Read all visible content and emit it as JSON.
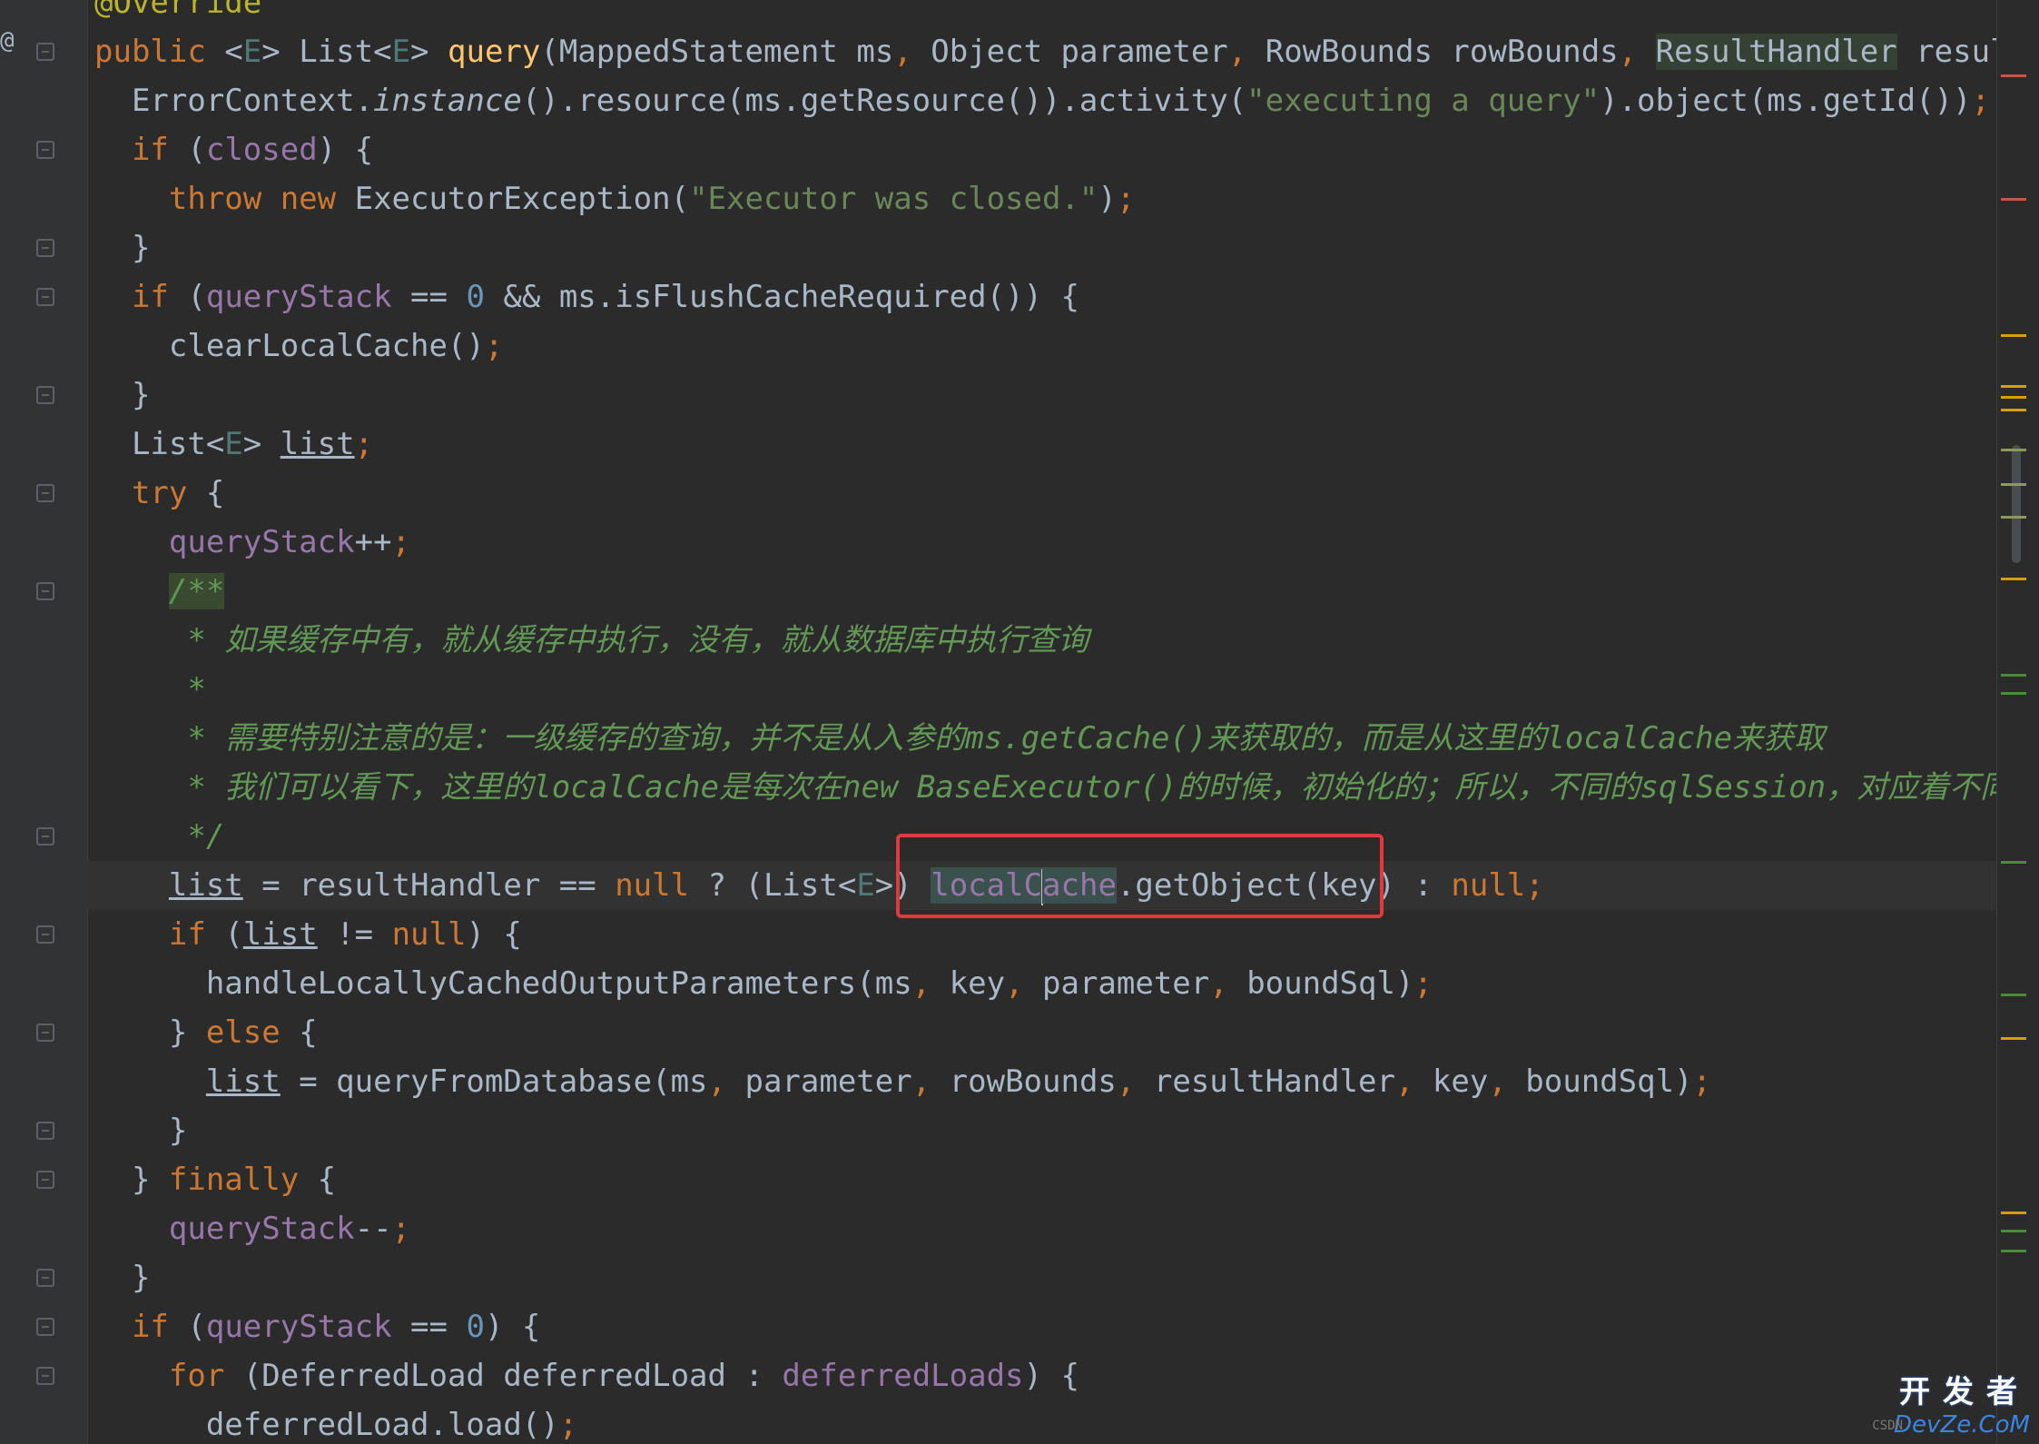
{
  "editor": {
    "gutter_symbol": "@",
    "lines": [
      [
        {
          "t": "@Override",
          "c": "ann"
        }
      ],
      [
        {
          "t": "public ",
          "c": "kw"
        },
        {
          "t": "<"
        },
        {
          "t": "E",
          "c": "gen"
        },
        {
          "t": "> List<"
        },
        {
          "t": "E",
          "c": "gen"
        },
        {
          "t": "> "
        },
        {
          "t": "query",
          "c": "fn"
        },
        {
          "t": "(MappedStatement ms"
        },
        {
          "t": ", ",
          "c": "kw"
        },
        {
          "t": "Object parameter"
        },
        {
          "t": ", ",
          "c": "kw"
        },
        {
          "t": "RowBounds rowBounds"
        },
        {
          "t": ", ",
          "c": "kw"
        },
        {
          "t": "ResultHandler",
          "c": "hl-type"
        },
        {
          "t": " resultHandler"
        }
      ],
      [
        {
          "t": "  ErrorContext."
        },
        {
          "t": "instance",
          "c": "ital"
        },
        {
          "t": "().resource(ms.getResource()).activity("
        },
        {
          "t": "\"executing a query\"",
          "c": "str"
        },
        {
          "t": ").object(ms.getId())"
        },
        {
          "t": ";",
          "c": "kw"
        }
      ],
      [
        {
          "t": "  "
        },
        {
          "t": "if ",
          "c": "kw"
        },
        {
          "t": "("
        },
        {
          "t": "closed",
          "c": "fld"
        },
        {
          "t": ") {"
        }
      ],
      [
        {
          "t": "    "
        },
        {
          "t": "throw new ",
          "c": "kw"
        },
        {
          "t": "ExecutorException("
        },
        {
          "t": "\"Executor was closed.\"",
          "c": "str"
        },
        {
          "t": ")"
        },
        {
          "t": ";",
          "c": "kw"
        }
      ],
      [
        {
          "t": "  }"
        }
      ],
      [
        {
          "t": "  "
        },
        {
          "t": "if ",
          "c": "kw"
        },
        {
          "t": "("
        },
        {
          "t": "queryStack",
          "c": "fld"
        },
        {
          "t": " == "
        },
        {
          "t": "0",
          "c": "num"
        },
        {
          "t": " && ms.isFlushCacheRequired()) {"
        }
      ],
      [
        {
          "t": "    clearLocalCache()"
        },
        {
          "t": ";",
          "c": "kw"
        }
      ],
      [
        {
          "t": "  }"
        }
      ],
      [
        {
          "t": "  List<"
        },
        {
          "t": "E",
          "c": "gen"
        },
        {
          "t": "> "
        },
        {
          "t": "list",
          "c": "ul"
        },
        {
          "t": ";",
          "c": "kw"
        }
      ],
      [
        {
          "t": "  "
        },
        {
          "t": "try ",
          "c": "kw"
        },
        {
          "t": "{"
        }
      ],
      [
        {
          "t": "    "
        },
        {
          "t": "queryStack",
          "c": "fld"
        },
        {
          "t": "++"
        },
        {
          "t": ";",
          "c": "kw"
        }
      ],
      [
        {
          "t": "    "
        },
        {
          "t": "/**",
          "c": "cmt hl-cmt"
        }
      ],
      [
        {
          "t": "     * 如果缓存中有，就从缓存中执行，没有，就从数据库中执行查询",
          "c": "cmt"
        }
      ],
      [
        {
          "t": "     *",
          "c": "cmt"
        }
      ],
      [
        {
          "t": "     * 需要特别注意的是：一级缓存的查询，并不是从入参的ms.getCache()来获取的，而是从这里的localCache来获取",
          "c": "cmt"
        }
      ],
      [
        {
          "t": "     * 我们可以看下，这里的localCache是每次在new BaseExecutor()的时候，初始化的；所以，不同的sqlSession，对应着不同的baseExecutor",
          "c": "cmt"
        }
      ],
      [
        {
          "t": "     */",
          "c": "cmt"
        }
      ],
      [
        {
          "t": "    "
        },
        {
          "t": "list",
          "c": "ul"
        },
        {
          "t": " = resultHandler == "
        },
        {
          "t": "null",
          "c": "kw"
        },
        {
          "t": " ? (List<"
        },
        {
          "t": "E",
          "c": "gen"
        },
        {
          "t": ">) "
        },
        {
          "t": "localC",
          "c": "hl-word"
        },
        {
          "t": "",
          "c": "caret"
        },
        {
          "t": "ache",
          "c": "hl-word"
        },
        {
          "t": ".getObject(key) : "
        },
        {
          "t": "null",
          "c": "kw"
        },
        {
          "t": ";",
          "c": "kw"
        }
      ],
      [
        {
          "t": "    "
        },
        {
          "t": "if ",
          "c": "kw"
        },
        {
          "t": "("
        },
        {
          "t": "list",
          "c": "ul"
        },
        {
          "t": " != "
        },
        {
          "t": "null",
          "c": "kw"
        },
        {
          "t": ") {"
        }
      ],
      [
        {
          "t": "      handleLocallyCachedOutputParameters(ms"
        },
        {
          "t": ", ",
          "c": "kw"
        },
        {
          "t": "key"
        },
        {
          "t": ", ",
          "c": "kw"
        },
        {
          "t": "parameter"
        },
        {
          "t": ", ",
          "c": "kw"
        },
        {
          "t": "boundSql)"
        },
        {
          "t": ";",
          "c": "kw"
        }
      ],
      [
        {
          "t": "    } "
        },
        {
          "t": "else ",
          "c": "kw"
        },
        {
          "t": "{"
        }
      ],
      [
        {
          "t": "      "
        },
        {
          "t": "list",
          "c": "ul"
        },
        {
          "t": " = queryFromDatabase(ms"
        },
        {
          "t": ", ",
          "c": "kw"
        },
        {
          "t": "parameter"
        },
        {
          "t": ", ",
          "c": "kw"
        },
        {
          "t": "rowBounds"
        },
        {
          "t": ", ",
          "c": "kw"
        },
        {
          "t": "resultHandler"
        },
        {
          "t": ", ",
          "c": "kw"
        },
        {
          "t": "key"
        },
        {
          "t": ", ",
          "c": "kw"
        },
        {
          "t": "boundSql)"
        },
        {
          "t": ";",
          "c": "kw"
        }
      ],
      [
        {
          "t": "    }"
        }
      ],
      [
        {
          "t": "  } "
        },
        {
          "t": "finally ",
          "c": "kw"
        },
        {
          "t": "{"
        }
      ],
      [
        {
          "t": "    "
        },
        {
          "t": "queryStack",
          "c": "fld"
        },
        {
          "t": "--"
        },
        {
          "t": ";",
          "c": "kw"
        }
      ],
      [
        {
          "t": "  }"
        }
      ],
      [
        {
          "t": "  "
        },
        {
          "t": "if ",
          "c": "kw"
        },
        {
          "t": "("
        },
        {
          "t": "queryStack",
          "c": "fld"
        },
        {
          "t": " == "
        },
        {
          "t": "0",
          "c": "num"
        },
        {
          "t": ") {"
        }
      ],
      [
        {
          "t": "    "
        },
        {
          "t": "for ",
          "c": "kw"
        },
        {
          "t": "(DeferredLoad deferredLoad : "
        },
        {
          "t": "deferredLoads",
          "c": "fld"
        },
        {
          "t": ") {"
        }
      ],
      [
        {
          "t": "      deferredLoad.load()"
        },
        {
          "t": ";",
          "c": "kw"
        }
      ]
    ],
    "colors": {
      "background": "#2b2b2b",
      "keyword": "#cc7832",
      "method": "#ffc66d",
      "string": "#6a8759",
      "number": "#6897bb",
      "field": "#9876aa",
      "comment": "#629755",
      "highlight_box": "#e0393e"
    }
  },
  "watermark": {
    "cn": "开发者",
    "en": "DevZe.CoM",
    "small": "CSDN"
  }
}
